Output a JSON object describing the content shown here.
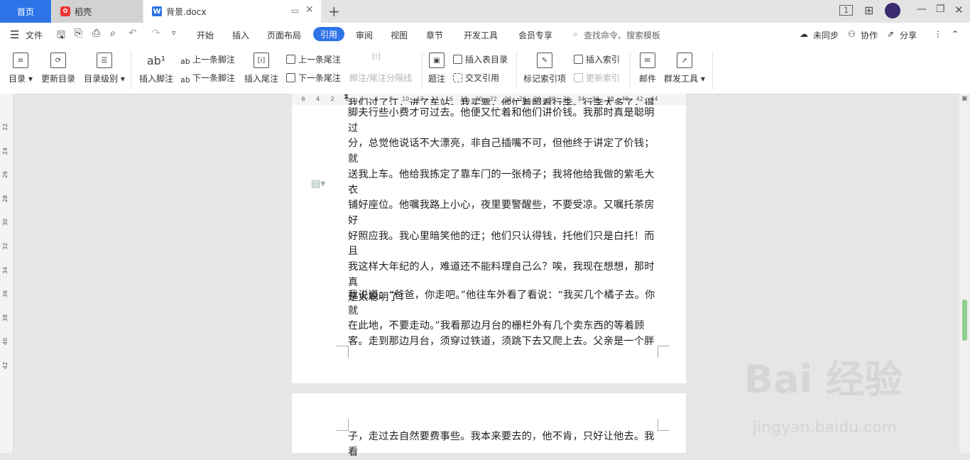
{
  "titlebar": {
    "home_tab": "首页",
    "daoke_tab": "稻壳",
    "doc_tab": "背景.docx",
    "window_badge": "1"
  },
  "menu": {
    "file": "文件",
    "items": [
      "开始",
      "插入",
      "页面布局",
      "引用",
      "审阅",
      "视图",
      "章节",
      "开发工具",
      "会员专享"
    ],
    "search": "查找命令、搜索模板",
    "sync": "未同步",
    "collab": "协作",
    "share": "分享"
  },
  "ribbon": {
    "toc": "目录",
    "update_toc": "更新目录",
    "toc_level": "目录级别",
    "insert_footnote": "插入脚注",
    "prev_footnote": "上一条脚注",
    "next_footnote": "下一条脚注",
    "insert_endnote": "插入尾注",
    "prev_endnote": "上一条尾注",
    "next_endnote": "下一条尾注",
    "separator": "脚注/尾注分隔线",
    "caption": "题注",
    "insert_table_toc": "插入表目录",
    "cross_ref": "交叉引用",
    "mark_index": "标记索引项",
    "insert_index": "插入索引",
    "update_index": "更新索引",
    "mail": "邮件",
    "mass_tool": "群发工具"
  },
  "ruler": {
    "h_ticks": [
      "6",
      "4",
      "2",
      "2",
      "4",
      "6",
      "8",
      "10",
      "12",
      "14",
      "16",
      "18",
      "20",
      "22",
      "24",
      "26",
      "28",
      "30",
      "32",
      "34",
      "36",
      "38",
      "40",
      "42",
      "44"
    ],
    "v_ticks": [
      "22",
      "24",
      "26",
      "28",
      "30",
      "32",
      "34",
      "36",
      "38",
      "40",
      "42"
    ]
  },
  "document": {
    "para1_lines": [
      "脚夫行些小费才可过去。他便又忙着和他们讲价钱。我那时真是聪明过",
      "分，总觉他说话不大漂亮，非自己插嘴不可，但他终于讲定了价钱；就",
      "送我上车。他给我拣定了靠车门的一张椅子；我将他给我做的紫毛大衣",
      "铺好座位。他嘱我路上小心，夜里要警醒些，不要受凉。又嘱托茶房好",
      "好照应我。我心里暗笑他的迂；他们只认得钱，托他们只是白托！而且",
      "我这样大年纪的人，难道还不能料理自己么？唉，我现在想想，那时真",
      "是太聪明了！"
    ],
    "para2_lines": [
      "我说道：“爸爸，你走吧。”他往车外看了看说：“我买几个橘子去。你就",
      "在此地，不要走动。”我看那边月台的栅栏外有几个卖东西的等着顾",
      "客。走到那边月台，须穿过铁道，须跳下去又爬上去。父亲是一个胖"
    ],
    "page2_lines": [
      "子，走过去自然要费事些。我本来要去的，他不肯，只好让他去。我看"
    ]
  },
  "watermark": {
    "brand": "Bai 经验",
    "site": "jingyan.baidu.com"
  },
  "colors": {
    "accent": "#2e74e8",
    "scroll_thumb": "#8fd08f"
  }
}
